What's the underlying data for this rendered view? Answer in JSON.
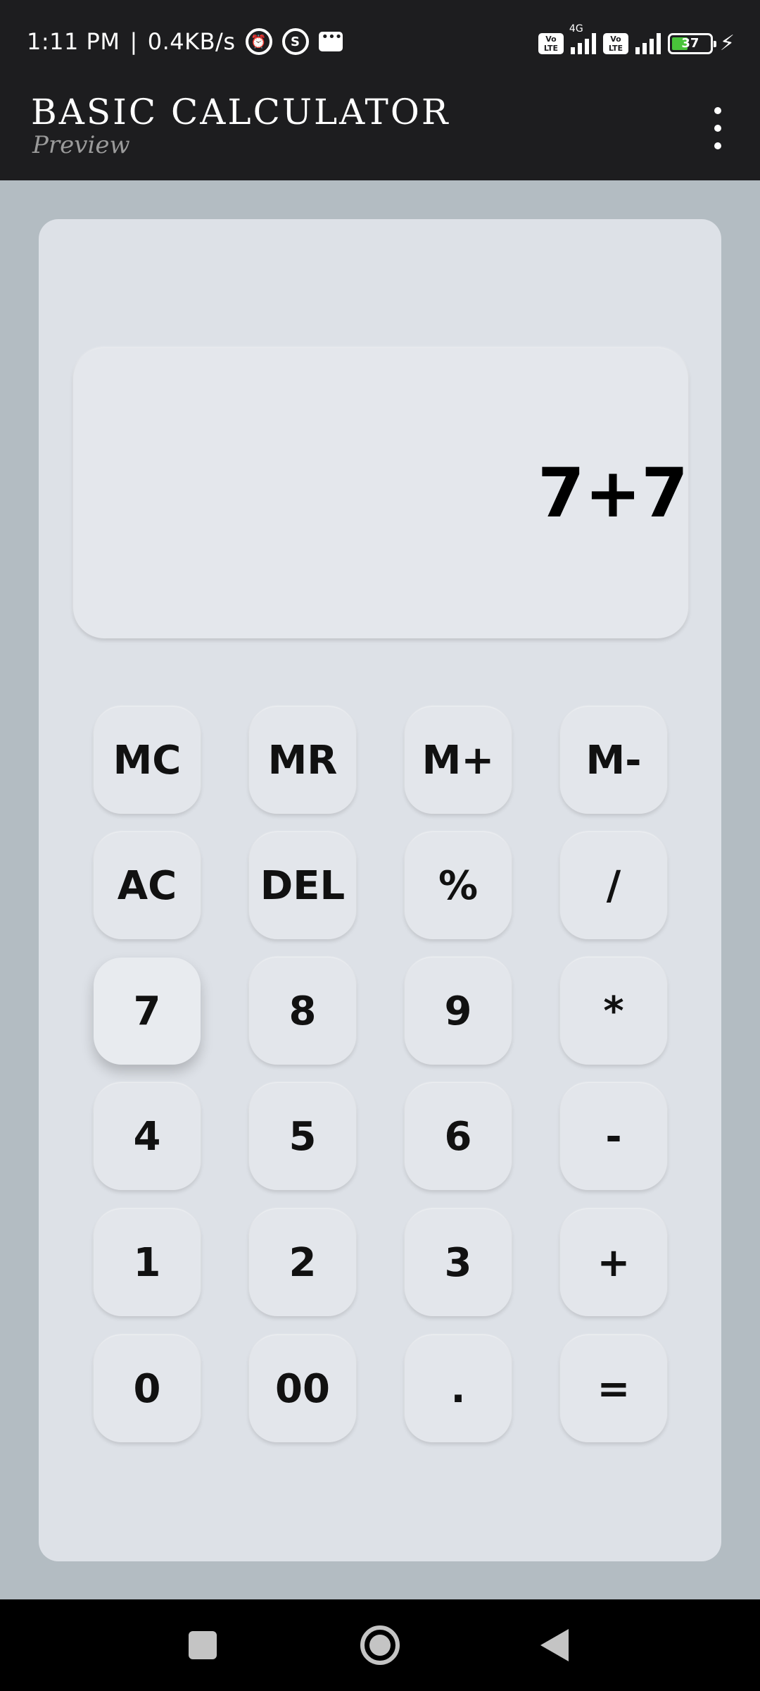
{
  "status_bar": {
    "time": "1:11 PM",
    "net_speed": "0.4KB/s",
    "network_type": "4G",
    "volte_label": "Vo LTE",
    "battery_level": "37",
    "icons": [
      "alarm-icon",
      "s-app-icon",
      "message-icon",
      "volte-icon",
      "signal-icon",
      "battery-icon",
      "charging-icon"
    ]
  },
  "app_bar": {
    "title": "BASIC CALCULATOR",
    "subtitle": "Preview",
    "menu_icon": "more-vert-icon"
  },
  "display": {
    "expression": "7+7"
  },
  "keypad": {
    "rows": [
      [
        "MC",
        "MR",
        "M+",
        "M-"
      ],
      [
        "AC",
        "DEL",
        "%",
        "/"
      ],
      [
        "7",
        "8",
        "9",
        "*"
      ],
      [
        "4",
        "5",
        "6",
        "-"
      ],
      [
        "1",
        "2",
        "3",
        "+"
      ],
      [
        "0",
        "00",
        ".",
        "="
      ]
    ]
  },
  "nav_bar": {
    "icons": [
      "recents-icon",
      "home-icon",
      "back-icon"
    ]
  },
  "colors": {
    "background": "#b3bcc2",
    "panel": "#dde1e7",
    "key": "#e3e6eb",
    "bar": "#1d1d1f",
    "battery_fill": "#49c43a"
  }
}
